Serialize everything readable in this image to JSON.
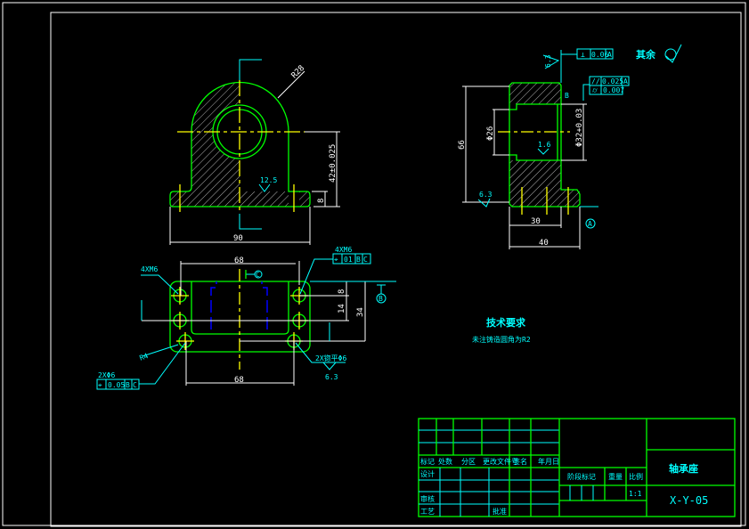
{
  "front_view": {
    "dim_radius": "R28",
    "dim_height": "42±0.025",
    "dim_base": "8",
    "dim_width": "90",
    "roughness": "12.5"
  },
  "side_view": {
    "dim_height": "66",
    "dim_bore": "Φ26",
    "dim_hole": "Φ32+0.03",
    "dim_30": "30",
    "dim_40": "40",
    "roughness_bore": "1.6",
    "roughness_base": "6.3",
    "roughness_top": "6.3",
    "datum": "A",
    "perpendicularity": {
      "symbol": "⊥",
      "value": "0.06",
      "datum": "A"
    },
    "parallelism": {
      "symbol": "//",
      "value": "0.025",
      "datum": "A"
    },
    "cylindricity": {
      "symbol": "⌭",
      "value": "0.007"
    },
    "other_label": "其余",
    "small_label": "B"
  },
  "top_view": {
    "dim_68_top": "68",
    "dim_68_bottom": "68",
    "dim_8": "8",
    "dim_14": "14",
    "dim_34": "34",
    "label_4xm6_left": "4XM6",
    "label_4xm6_right": "4XM6",
    "position_right": {
      "value": "01",
      "datum1": "B",
      "datum2": "C"
    },
    "label_2x6": "2XΦ6",
    "position_left": {
      "value": "0.05",
      "datum1": "B",
      "datum2": "C"
    },
    "label_2x_right": "2X锪平Φ6",
    "roughness": "6.3",
    "radius": "R4",
    "datum_b": "B",
    "datum_c": "C"
  },
  "tech_req": {
    "title": "技术要求",
    "line1": "未注铸造圆角为R2"
  },
  "title_block": {
    "headers": [
      "标记",
      "处数",
      "分区",
      "更改文件号",
      "签名",
      "年月日"
    ],
    "design": "设计",
    "review": "审核",
    "process": "工艺",
    "approve": "批准",
    "stage_mark": "阶段标记",
    "weight": "重量",
    "scale_label": "比例",
    "scale": "1:1",
    "part_name": "轴承座",
    "drawing_no": "X-Y-05"
  }
}
